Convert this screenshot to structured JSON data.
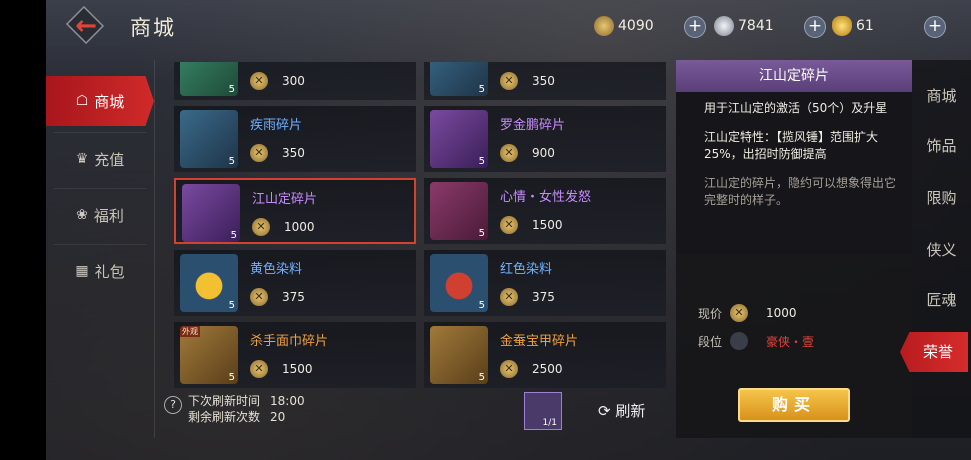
{
  "header": {
    "title": "商城",
    "currencies": [
      {
        "icon": "honor-token-icon",
        "value": "4090",
        "color": "#d6b25a"
      },
      {
        "icon": "silver-coin-icon",
        "value": "7841",
        "color": "#c9ced6"
      },
      {
        "icon": "gold-ingot-icon",
        "value": "61",
        "color": "#f0c040"
      }
    ]
  },
  "left_nav": {
    "items": [
      {
        "label": "商城",
        "icon": "shop-icon",
        "active": true
      },
      {
        "label": "充值",
        "icon": "recharge-icon",
        "active": false
      },
      {
        "label": "福利",
        "icon": "welfare-icon",
        "active": false
      },
      {
        "label": "礼包",
        "icon": "gift-icon",
        "active": false
      }
    ]
  },
  "shop_items": [
    {
      "name": "",
      "price": "300",
      "qty": "5",
      "name_color": "#6fb0ff",
      "art_color": "#2e6a52"
    },
    {
      "name": "",
      "price": "350",
      "qty": "5",
      "name_color": "#6fb0ff",
      "art_color": "#2b4f6e"
    },
    {
      "name": "疾雨碎片",
      "price": "350",
      "qty": "5",
      "name_color": "#6fb0ff",
      "art_color": "#2b4f6e"
    },
    {
      "name": "罗金鹏碎片",
      "price": "900",
      "qty": "5",
      "name_color": "#c78bff",
      "art_color": "#5a3a7a"
    },
    {
      "name": "江山定碎片",
      "price": "1000",
      "qty": "5",
      "name_color": "#c78bff",
      "art_color": "#5a3a7a"
    },
    {
      "name": "心情・女性发怒",
      "price": "1500",
      "qty": "5",
      "name_color": "#c78bff",
      "art_color": "#6a2a4a"
    },
    {
      "name": "黄色染料",
      "price": "375",
      "qty": "5",
      "name_color": "#6fb0ff",
      "art_color": "#2b4f6e"
    },
    {
      "name": "红色染料",
      "price": "375",
      "qty": "5",
      "name_color": "#6fb0ff",
      "art_color": "#2b4f6e"
    },
    {
      "name": "杀手面巾碎片",
      "price": "1500",
      "qty": "5",
      "name_color": "#f0a040",
      "art_color": "#7a5a2a",
      "tag": "外观"
    },
    {
      "name": "金蚕宝甲碎片",
      "price": "2500",
      "qty": "5",
      "name_color": "#f0a040",
      "art_color": "#7a5a2a"
    }
  ],
  "refresh": {
    "next_label": "下次刷新时间",
    "next_value": "18:00",
    "remaining_label": "剩余刷新次数",
    "remaining_value": "20",
    "token_qty": "1/1",
    "refresh_label": "刷新",
    "refresh_icon": "refresh-icon"
  },
  "detail": {
    "title": "江山定碎片",
    "desc1": "用于江山定的激活（50个）及升星",
    "desc2": "江山定特性：【揽风锤】范围扩大25%，出招时防御提高",
    "desc3": "江山定的碎片，隐约可以想象得出它完整时的样子。",
    "price_label": "现价",
    "price_value": "1000",
    "rank_label": "段位",
    "rank_value": "豪侠・壹",
    "buy_label": "购买"
  },
  "right_tabs": {
    "items": [
      {
        "label": "商城",
        "active": false
      },
      {
        "label": "饰品",
        "active": false
      },
      {
        "label": "限购",
        "active": false
      },
      {
        "label": "侠义",
        "active": false
      },
      {
        "label": "匠魂",
        "active": false
      },
      {
        "label": "荣誉",
        "active": true
      }
    ]
  }
}
